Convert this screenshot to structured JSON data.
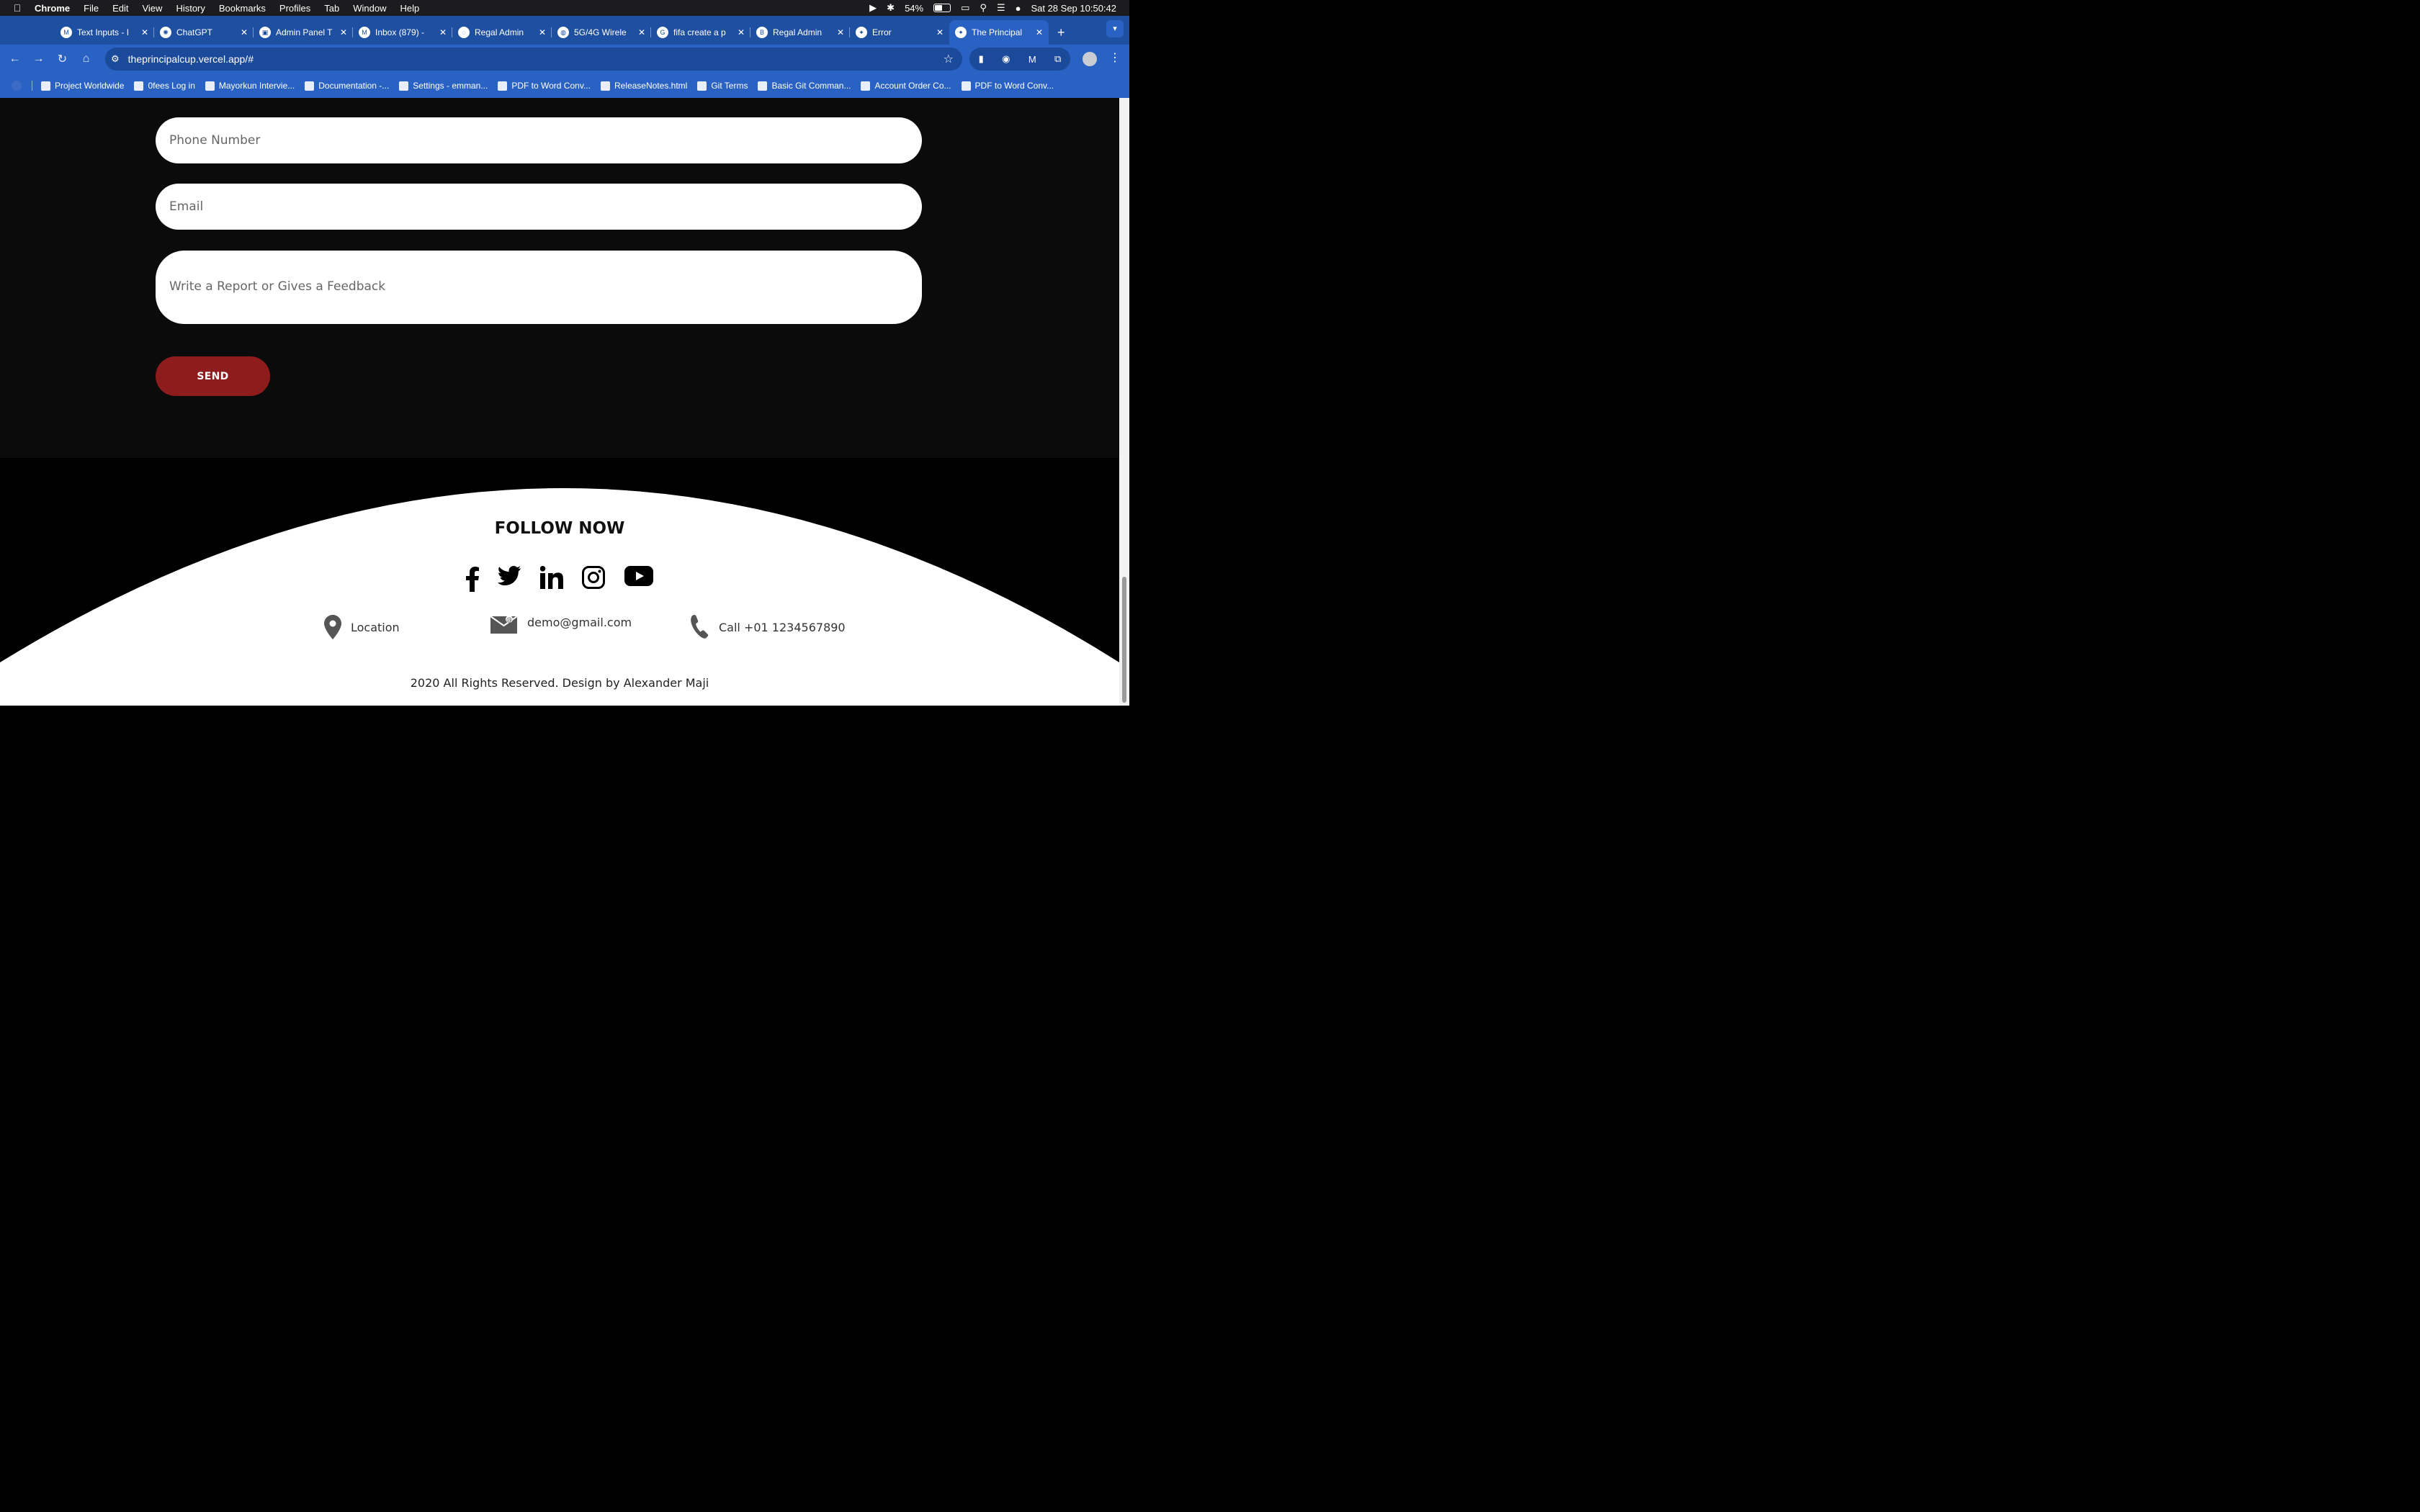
{
  "menubar": {
    "app": "Chrome",
    "items": [
      "File",
      "Edit",
      "View",
      "History",
      "Bookmarks",
      "Profiles",
      "Tab",
      "Window",
      "Help"
    ],
    "battery": "54%",
    "datetime": "Sat 28 Sep  10:50:42"
  },
  "tabs": [
    {
      "label": "Text Inputs - I",
      "active": false
    },
    {
      "label": "ChatGPT",
      "active": false
    },
    {
      "label": "Admin Panel T",
      "active": false
    },
    {
      "label": "Inbox (879) -",
      "active": false
    },
    {
      "label": "Regal Admin",
      "active": false
    },
    {
      "label": "5G/4G Wirele",
      "active": false
    },
    {
      "label": "fifa create a p",
      "active": false
    },
    {
      "label": "Regal Admin",
      "active": false
    },
    {
      "label": "Error",
      "active": false
    },
    {
      "label": "The Principal",
      "active": true
    }
  ],
  "address": {
    "url": "theprincipalcup.vercel.app/#"
  },
  "bookmarks": [
    "Project Worldwide",
    "0fees Log in",
    "Mayorkun Intervie...",
    "Documentation -...",
    "Settings - emman...",
    "PDF to Word Conv...",
    "ReleaseNotes.html",
    "Git Terms",
    "Basic Git Comman...",
    "Account Order Co...",
    "PDF to Word Conv..."
  ],
  "form": {
    "phone_placeholder": "Phone Number",
    "email_placeholder": "Email",
    "message_placeholder": "Write a Report or Gives a Feedback",
    "send_label": "SEND"
  },
  "footer": {
    "follow_title": "FOLLOW NOW",
    "socials": [
      "facebook-icon",
      "twitter-icon",
      "linkedin-icon",
      "instagram-icon",
      "youtube-icon"
    ],
    "location": "Location",
    "email": "demo@gmail.com",
    "phone": "Call +01 1234567890",
    "copyright": "2020 All Rights Reserved. Design by Alexander Maji"
  },
  "colors": {
    "send_button": "#8e1c1c",
    "browser_chrome": "#2a62c3",
    "page_bg": "#0b0b0b"
  },
  "scroll": {
    "position_fraction": 0.95
  }
}
